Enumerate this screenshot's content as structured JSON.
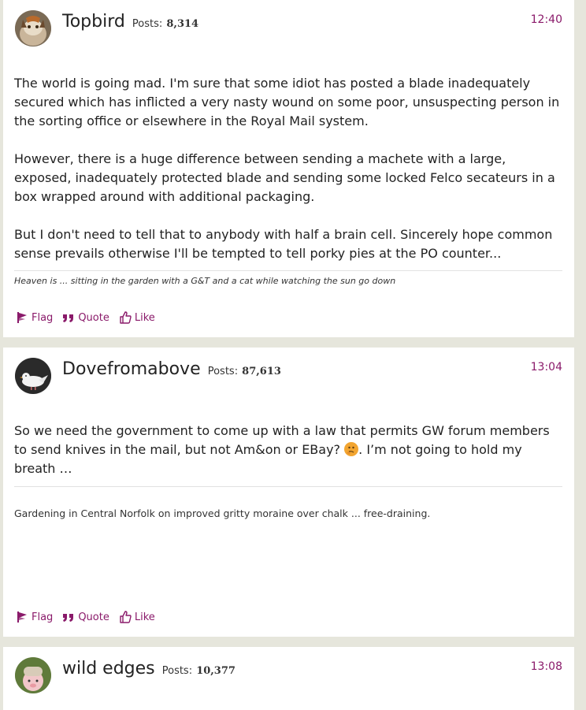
{
  "posts": [
    {
      "username": "Topbird",
      "posts_label": "Posts:",
      "posts_count": "8,314",
      "time": "12:40",
      "paragraphs": [
        "The world is going mad. I'm sure that some idiot has posted a blade inadequately secured which has inflicted a very nasty wound on some poor, unsuspecting person in the sorting office or elsewhere in the Royal Mail system.",
        "However, there is a huge difference between sending a machete with a large, exposed, inadequately protected blade and sending some locked Felco secateurs in a box wrapped around with additional packaging.",
        "But I don't need to tell that to anybody with half a brain cell. Sincerely hope common sense prevails otherwise I'll be tempted to tell porky pies at the PO counter..."
      ],
      "signature": "Heaven is ... sitting in the garden with a G&T and a cat while watching the sun go down",
      "actions": {
        "flag": "Flag",
        "quote": "Quote",
        "like": "Like"
      }
    },
    {
      "username": "Dovefromabove",
      "posts_label": "Posts:",
      "posts_count": "87,613",
      "time": "13:04",
      "paragraph_before_emoji": "So we need the government to come up with a law that permits GW forum members to send knives in the mail, but not Am&on or EBay?",
      "paragraph_after_emoji": ". I’m not going to hold my breath …",
      "signature": "Gardening in Central Norfolk on improved gritty moraine over chalk ... free-draining.",
      "actions": {
        "flag": "Flag",
        "quote": "Quote",
        "like": "Like"
      }
    },
    {
      "username": "wild edges",
      "posts_label": "Posts:",
      "posts_count": "10,377",
      "time": "13:08"
    }
  ],
  "icons": {
    "flag": "flag-icon",
    "quote": "quote-icon",
    "like": "thumbs-up-icon",
    "emoji": "thinking-face-emoji-icon"
  },
  "colors": {
    "accent": "#8a1a6a",
    "page_background": "#e6e6dc",
    "card_background": "#ffffff"
  }
}
